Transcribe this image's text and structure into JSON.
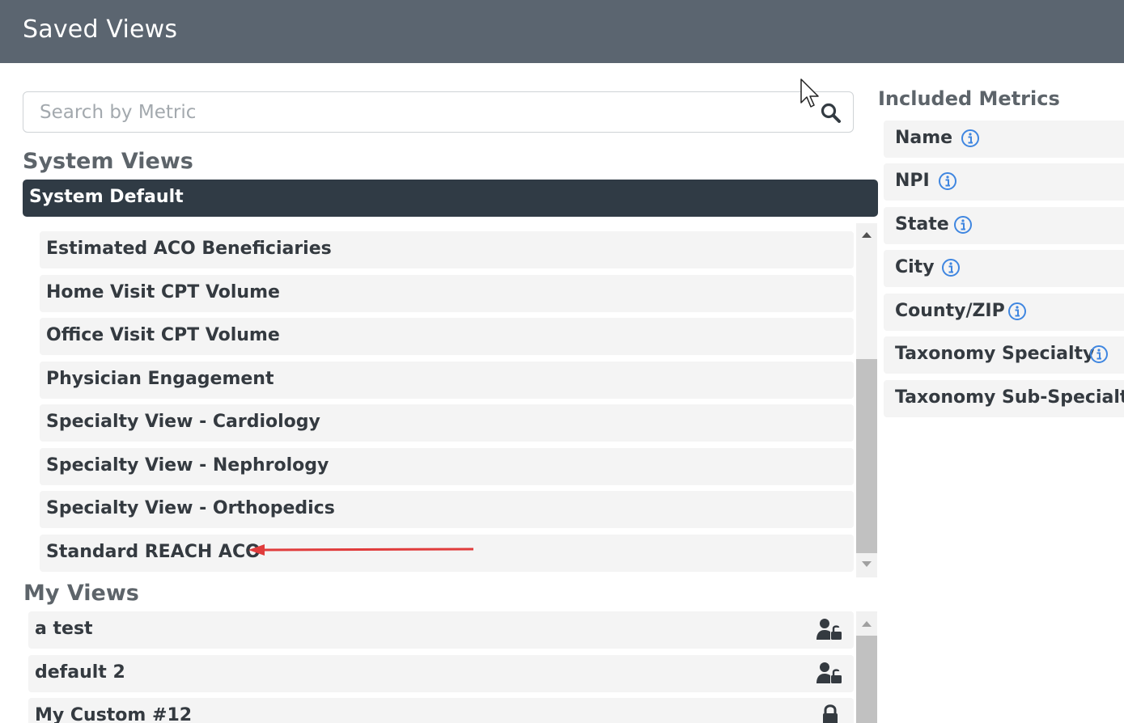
{
  "header": {
    "title": "Saved Views"
  },
  "search": {
    "placeholder": "Search by Metric",
    "value": ""
  },
  "system_views": {
    "title": "System Views",
    "selected": "System Default",
    "items": [
      {
        "label": "Estimated ACO Beneficiaries"
      },
      {
        "label": "Home Visit CPT Volume"
      },
      {
        "label": "Office Visit CPT Volume"
      },
      {
        "label": "Physician Engagement"
      },
      {
        "label": "Specialty View - Cardiology"
      },
      {
        "label": "Specialty View - Nephrology"
      },
      {
        "label": "Specialty View - Orthopedics"
      },
      {
        "label": "Standard REACH ACO"
      }
    ]
  },
  "my_views": {
    "title": "My Views",
    "items": [
      {
        "label": "a test",
        "icon": "user-unlock-icon"
      },
      {
        "label": "default 2",
        "icon": "user-unlock-icon"
      },
      {
        "label": "My Custom #12",
        "icon": "lock-icon"
      }
    ]
  },
  "included_metrics": {
    "title": "Included Metrics",
    "items": [
      {
        "label": "Name",
        "info": true
      },
      {
        "label": "NPI",
        "info": true
      },
      {
        "label": "State",
        "info": true
      },
      {
        "label": "City",
        "info": true
      },
      {
        "label": "County/ZIP",
        "info": true
      },
      {
        "label": "Taxonomy Specialty",
        "info": true
      },
      {
        "label": "Taxonomy Sub-Specialty",
        "info": false
      }
    ]
  },
  "colors": {
    "header_bg": "#5b6570",
    "selected_bg": "#303b45",
    "row_bg": "#f4f4f4",
    "info_icon": "#3f86e0",
    "annotation_arrow": "#e03c3c"
  }
}
